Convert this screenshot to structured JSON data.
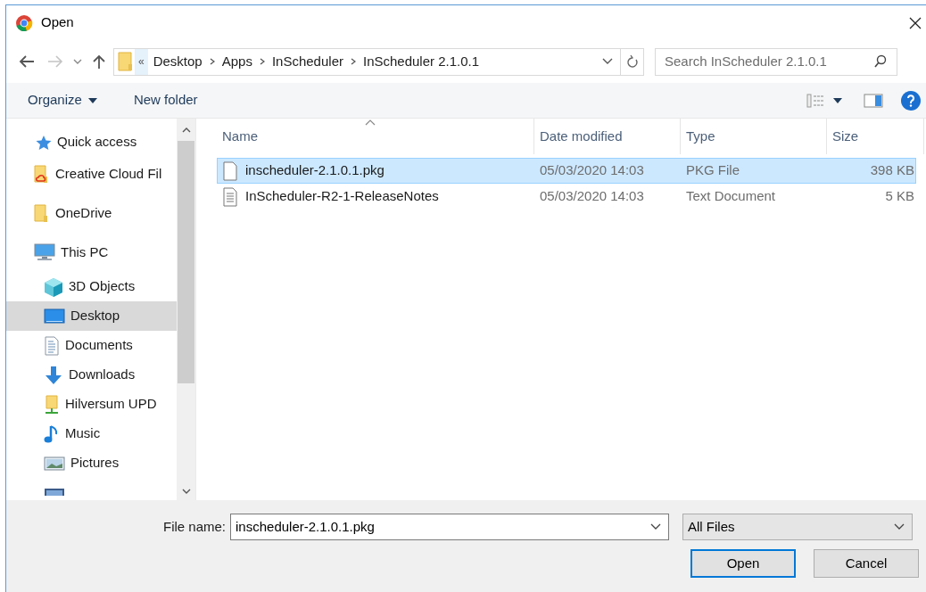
{
  "window": {
    "title": "Open"
  },
  "address_bar": {
    "overflow": "«",
    "crumbs": [
      "Desktop",
      "Apps",
      "InScheduler",
      "InScheduler 2.1.0.1"
    ]
  },
  "search": {
    "placeholder": "Search InScheduler 2.1.0.1"
  },
  "toolbar": {
    "organize": "Organize",
    "new_folder": "New folder"
  },
  "sidebar": {
    "items": [
      {
        "label": "Quick access",
        "kind": "star",
        "selected": false
      },
      {
        "label": "Creative Cloud Fil",
        "kind": "cloud-folder",
        "selected": false
      },
      {
        "label": "OneDrive",
        "kind": "folder",
        "selected": false
      },
      {
        "label": "This PC",
        "kind": "pc",
        "selected": false,
        "children": [
          {
            "label": "3D Objects",
            "kind": "cube",
            "selected": false
          },
          {
            "label": "Desktop",
            "kind": "desktop",
            "selected": true
          },
          {
            "label": "Documents",
            "kind": "document",
            "selected": false
          },
          {
            "label": "Downloads",
            "kind": "download",
            "selected": false
          },
          {
            "label": "Hilversum UPD",
            "kind": "network-folder",
            "selected": false
          },
          {
            "label": "Music",
            "kind": "music",
            "selected": false
          },
          {
            "label": "Pictures",
            "kind": "pictures",
            "selected": false
          },
          {
            "kind": "video",
            "selected": false
          }
        ]
      }
    ]
  },
  "table": {
    "columns": [
      "Name",
      "Date modified",
      "Type",
      "Size"
    ],
    "rows": [
      {
        "name": "inscheduler-2.1.0.1.pkg",
        "date": "05/03/2020 14:03",
        "type": "PKG File",
        "size": "398 KB",
        "kind": "blank",
        "selected": true
      },
      {
        "name": "InScheduler-R2-1-ReleaseNotes",
        "date": "05/03/2020 14:03",
        "type": "Text Document",
        "size": "5 KB",
        "kind": "text",
        "selected": false
      }
    ]
  },
  "file_name": {
    "label": "File name:",
    "value": "inscheduler-2.1.0.1.pkg"
  },
  "file_type": {
    "value": "All Files"
  },
  "buttons": [
    {
      "label": "Open",
      "default": true
    },
    {
      "label": "Cancel",
      "default": false
    }
  ]
}
